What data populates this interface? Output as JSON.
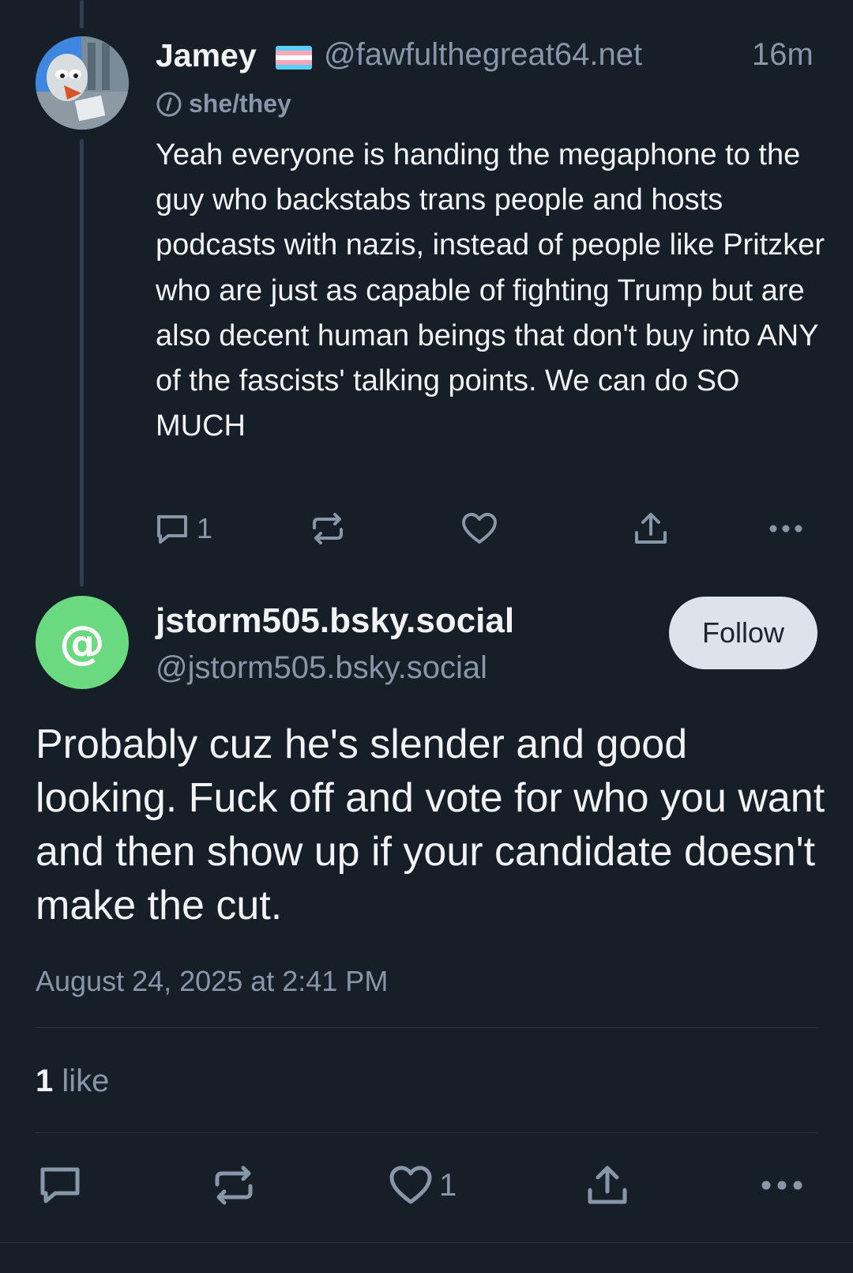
{
  "parent_post": {
    "display_name": "Jamey",
    "flag_emoji": "🏳️‍⚧️",
    "handle": "@fawfulthegreat64.net",
    "time": "16m",
    "pronouns": "she/they",
    "text": "Yeah everyone is handing the megaphone to the guy who backstabs trans people and hosts podcasts with nazis, instead of people like Pritzker who are just as capable of fighting Trump but are also decent human beings that don't buy into ANY of the fascists' talking points. We can do SO MUCH",
    "reply_count": "1",
    "icons": [
      "reply-icon",
      "repost-icon",
      "like-icon",
      "share-icon",
      "more-icon"
    ]
  },
  "main_post": {
    "display_name": "jstorm505.bsky.social",
    "handle": "@jstorm505.bsky.social",
    "follow_label": "Follow",
    "avatar_symbol": "@",
    "text": "Probably cuz he's slender and good looking. Fuck off and vote for who you want and then show up if your candidate doesn't make the cut.",
    "timestamp": "August 24, 2025 at 2:41 PM",
    "like_count_number": "1",
    "like_count_label": "like",
    "like_action_count": "1"
  },
  "colors": {
    "background": "#161e27",
    "text": "#f1f3f5",
    "muted": "#8796a8",
    "thread_line": "#2e3e4f",
    "follow_button": "#dde3ea",
    "default_avatar": "#6bd97f"
  }
}
